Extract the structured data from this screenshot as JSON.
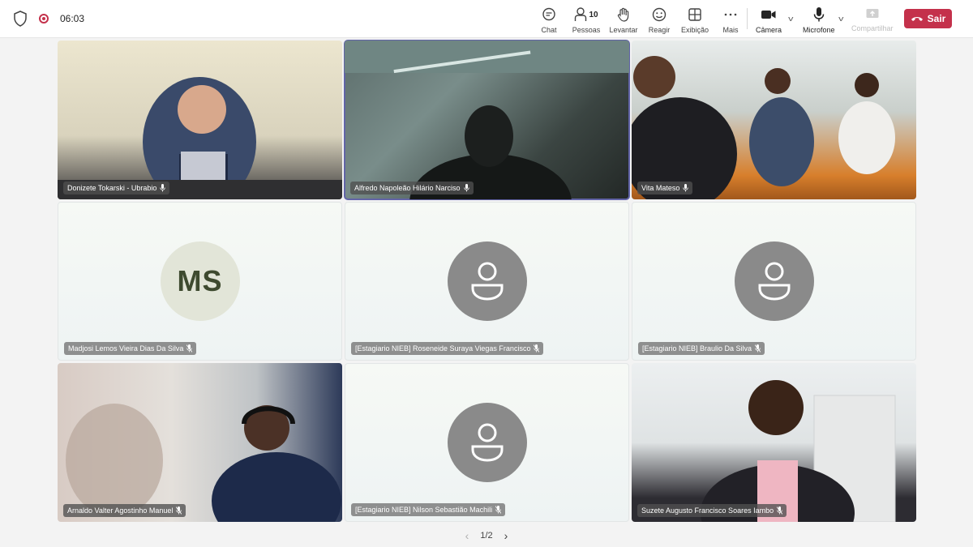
{
  "topbar": {
    "timer": "06:03",
    "tools": {
      "chat": "Chat",
      "people": "Pessoas",
      "people_count": "10",
      "raise": "Levantar",
      "react": "Reagir",
      "view": "Exibição",
      "more": "Mais"
    },
    "camera": "Câmera",
    "microphone": "Microfone",
    "share": "Compartilhar",
    "leave": "Sair",
    "leave_color": "#c4314b"
  },
  "participants": [
    {
      "name": "Donizete Tokarski - Ubrabio",
      "type": "video"
    },
    {
      "name": "Alfredo Napoleão Hilário Narciso",
      "type": "video",
      "active": true
    },
    {
      "name": "Vita Mateso",
      "type": "video"
    },
    {
      "name": "Madjosi Lemos Vieira Dias Da Silva",
      "type": "initials",
      "initials": "MS",
      "muted": true
    },
    {
      "name": "[Estagiario NIEB] Roseneide Suraya Viegas Francisco",
      "type": "avatar",
      "muted": true
    },
    {
      "name": "[Estagiario NIEB] Braulio Da Silva",
      "type": "avatar",
      "muted": true
    },
    {
      "name": "Arnaldo Valter Agostinho Manuel",
      "type": "video",
      "muted": true
    },
    {
      "name": "[Estagiario NIEB] Nilson Sebastião Machili",
      "type": "avatar",
      "muted": true
    },
    {
      "name": "Suzete Augusto Francisco Soares Iambo",
      "type": "video",
      "muted": true
    }
  ],
  "pager": {
    "label": "1/2"
  },
  "colors": {
    "accent": "#6264a7",
    "leave": "#c4314b"
  }
}
